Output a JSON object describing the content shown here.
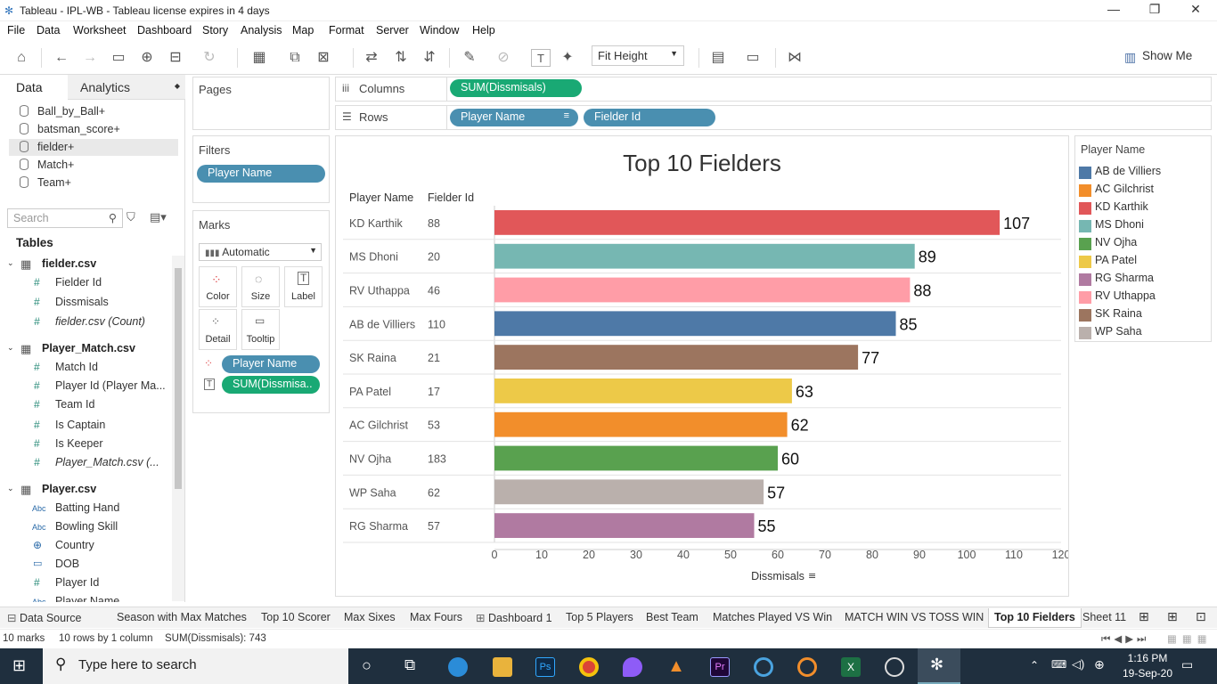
{
  "window": {
    "title": "Tableau - IPL-WB - Tableau license expires in 4 days"
  },
  "menu": [
    "File",
    "Data",
    "Worksheet",
    "Dashboard",
    "Story",
    "Analysis",
    "Map",
    "Format",
    "Server",
    "Window",
    "Help"
  ],
  "toolbar": {
    "fit": "Fit Height",
    "show_me": "Show Me"
  },
  "datapane": {
    "tab_data": "Data",
    "tab_analytics": "Analytics",
    "sources": [
      "Ball_by_Ball+",
      "batsman_score+",
      "fielder+",
      "Match+",
      "Team+"
    ],
    "search_placeholder": "Search",
    "tables_label": "Tables",
    "tables": [
      {
        "name": "fielder.csv",
        "fields": [
          "Fielder Id",
          "Dissmisals",
          "fielder.csv (Count)"
        ]
      },
      {
        "name": "Player_Match.csv",
        "fields": [
          "Match Id",
          "Player Id (Player Ma...",
          "Team Id",
          "Is Captain",
          "Is Keeper",
          "Player_Match.csv (..."
        ]
      },
      {
        "name": "Player.csv",
        "fields": [
          "Batting Hand",
          "Bowling Skill",
          "Country",
          "DOB",
          "Player Id",
          "Player Name"
        ]
      }
    ]
  },
  "shelves": {
    "pages": "Pages",
    "filters": "Filters",
    "filter_pill": "Player Name",
    "marks": "Marks",
    "marks_type": "Automatic",
    "mark_buttons": [
      "Color",
      "Size",
      "Label",
      "Detail",
      "Tooltip"
    ],
    "marks_pill_color": "Player Name",
    "marks_pill_label": "SUM(Dissmisa..",
    "columns_label": "Columns",
    "columns_pill": "SUM(Dissmisals)",
    "rows_label": "Rows",
    "rows_pills": [
      "Player Name",
      "Fielder Id"
    ]
  },
  "chart_data": {
    "type": "bar",
    "title": "Top 10 Fielders",
    "row_headers": [
      "Player Name",
      "Fielder Id"
    ],
    "categories": [
      "KD Karthik",
      "MS Dhoni",
      "RV Uthappa",
      "AB de Villiers",
      "SK Raina",
      "PA Patel",
      "AC Gilchrist",
      "NV Ojha",
      "WP Saha",
      "RG Sharma"
    ],
    "fielder_ids": [
      "88",
      "20",
      "46",
      "110",
      "21",
      "17",
      "53",
      "183",
      "62",
      "57"
    ],
    "values": [
      107,
      89,
      88,
      85,
      77,
      63,
      62,
      60,
      57,
      55
    ],
    "colors": [
      "#e15759",
      "#76b7b2",
      "#ff9da7",
      "#4e79a7",
      "#9c755f",
      "#edc948",
      "#f28e2b",
      "#59a14f",
      "#bab0ac",
      "#b07aa1"
    ],
    "xlabel": "Dissmisals",
    "xlim": [
      0,
      120
    ],
    "xticks": [
      0,
      10,
      20,
      30,
      40,
      50,
      60,
      70,
      80,
      90,
      100,
      110,
      120
    ]
  },
  "legend": {
    "title": "Player Name",
    "items": [
      {
        "name": "AB de Villiers",
        "color": "#4e79a7"
      },
      {
        "name": "AC Gilchrist",
        "color": "#f28e2b"
      },
      {
        "name": "KD Karthik",
        "color": "#e15759"
      },
      {
        "name": "MS Dhoni",
        "color": "#76b7b2"
      },
      {
        "name": "NV Ojha",
        "color": "#59a14f"
      },
      {
        "name": "PA Patel",
        "color": "#edc948"
      },
      {
        "name": "RG Sharma",
        "color": "#b07aa1"
      },
      {
        "name": "RV Uthappa",
        "color": "#ff9da7"
      },
      {
        "name": "SK Raina",
        "color": "#9c755f"
      },
      {
        "name": "WP Saha",
        "color": "#bab0ac"
      }
    ]
  },
  "sheet_tabs": [
    "Data Source",
    "Season with Max Matches",
    "Top 10 Scorer",
    "Max  Sixes",
    "Max Fours",
    "Dashboard 1",
    "Top 5 Players",
    "Best Team",
    "Matches Played VS Win",
    "MATCH WIN VS TOSS WIN",
    "Top 10 Fielders",
    "Sheet 11"
  ],
  "status": {
    "marks": "10 marks",
    "rows": "10 rows by 1 column",
    "sum": "SUM(Dissmisals): 743"
  },
  "taskbar": {
    "search": "Type here to search",
    "time": "1:16 PM",
    "date": "19-Sep-20"
  }
}
